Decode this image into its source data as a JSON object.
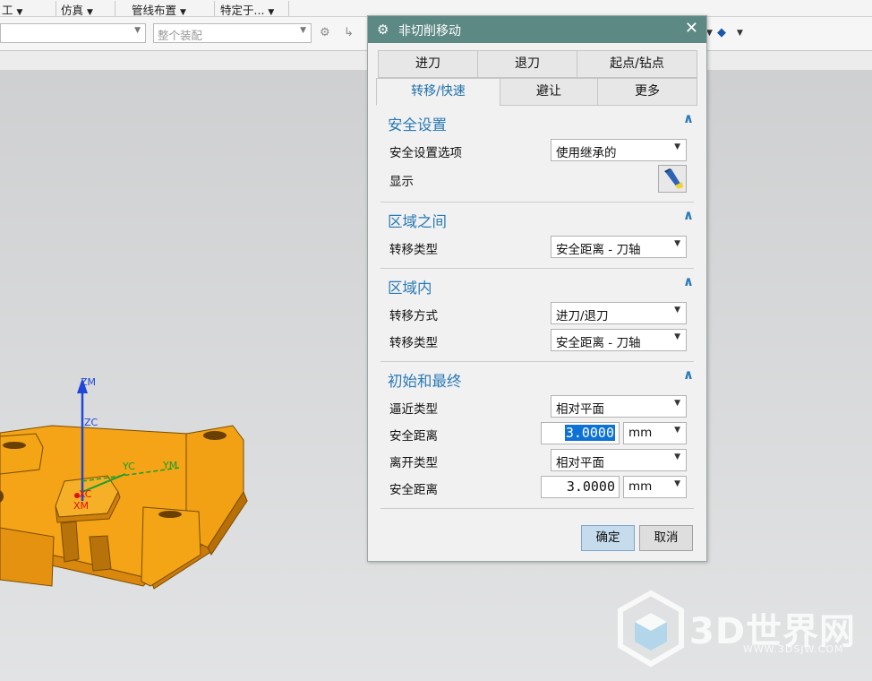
{
  "menubar": {
    "items": [
      "工",
      "仿真",
      "管线布置",
      "特定于..."
    ]
  },
  "toolbar": {
    "combo_left": "",
    "assembly_filter": "整个装配"
  },
  "model": {
    "axis_labels": [
      "ZM",
      "ZC",
      "YC",
      "YM",
      "XC",
      "XM"
    ]
  },
  "dialog": {
    "title": "非切削移动",
    "tabs_row1": [
      "进刀",
      "退刀",
      "起点/钻点"
    ],
    "tabs_row2": [
      "转移/快速",
      "避让",
      "更多"
    ],
    "active_tab": "转移/快速",
    "sections": {
      "safety": {
        "title": "安全设置",
        "option_label": "安全设置选项",
        "option_value": "使用继承的",
        "display_label": "显示"
      },
      "between_regions": {
        "title": "区域之间",
        "transfer_type_label": "转移类型",
        "transfer_type_value": "安全距离 - 刀轴"
      },
      "within_region": {
        "title": "区域内",
        "transfer_method_label": "转移方式",
        "transfer_method_value": "进刀/退刀",
        "transfer_type_label": "转移类型",
        "transfer_type_value": "安全距离 - 刀轴"
      },
      "initial_final": {
        "title": "初始和最终",
        "approach_type_label": "逼近类型",
        "approach_type_value": "相对平面",
        "approach_distance_label": "安全距离",
        "approach_distance_value": "3.0000",
        "approach_distance_unit": "mm",
        "depart_type_label": "离开类型",
        "depart_type_value": "相对平面",
        "depart_distance_label": "安全距离",
        "depart_distance_value": "3.0000",
        "depart_distance_unit": "mm"
      }
    },
    "ok_label": "确定",
    "cancel_label": "取消"
  },
  "watermark": {
    "brand": "3D世界网",
    "url": "WWW.3DSJW.COM"
  },
  "colors": {
    "title_bar": "#5d8985",
    "section_title": "#2a7ab5",
    "part_orange": "#f4a416",
    "selection": "#0d72d6"
  }
}
